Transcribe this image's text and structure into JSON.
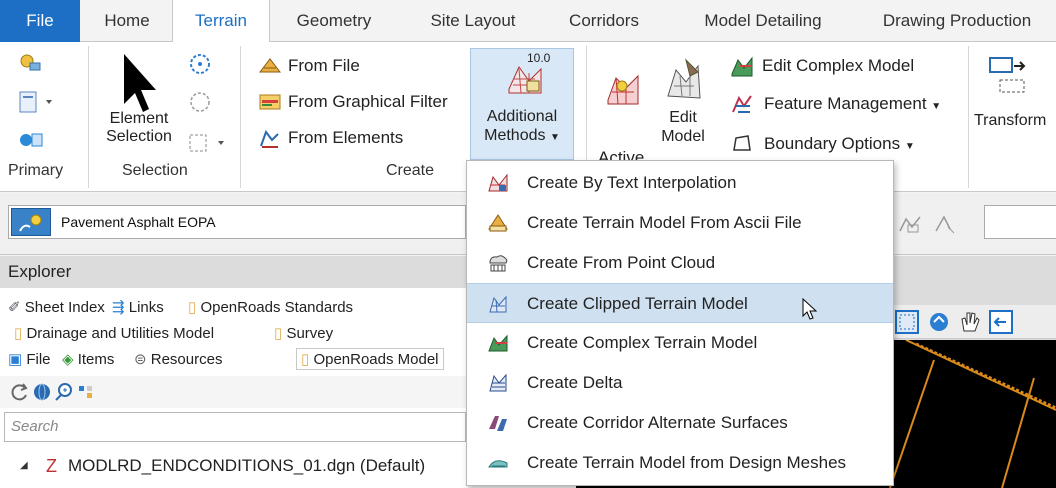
{
  "tabs": [
    "File",
    "Home",
    "Terrain",
    "Geometry",
    "Site Layout",
    "Corridors",
    "Model Detailing",
    "Drawing Production"
  ],
  "ribbon": {
    "primary": {
      "label": "Primary"
    },
    "selection": {
      "label": "Selection",
      "element_selection_line1": "Element",
      "element_selection_line2": "Selection"
    },
    "create": {
      "label": "Create",
      "from_file": "From File",
      "from_graphical_filter": "From Graphical Filter",
      "from_elements": "From Elements"
    },
    "additional_methods": {
      "badge": "10.0",
      "line1": "Additional",
      "line2": "Methods"
    },
    "active": {
      "label": "Active"
    },
    "edit_model": {
      "line1": "Edit",
      "line2": "Model"
    },
    "edit_complex_model": "Edit Complex Model",
    "feature_management": "Feature Management",
    "boundary_options": "Boundary Options",
    "transform": "Transform"
  },
  "feature_bar": {
    "feature_definition": "Pavement Asphalt EOPA"
  },
  "explorer": {
    "title": "Explorer",
    "tabs_row1": [
      "Sheet Index",
      "Links",
      "OpenRoads Standards"
    ],
    "tabs_row2": [
      "Drainage and Utilities Model",
      "Survey"
    ],
    "tabs_row3": [
      "File",
      "Items",
      "Resources",
      "OpenRoads Model"
    ],
    "search_placeholder": "Search",
    "tree_item": "MODLRD_ENDCONDITIONS_01.dgn (Default)"
  },
  "dropdown": {
    "items": [
      "Create By Text Interpolation",
      "Create Terrain Model From Ascii File",
      "Create From Point Cloud",
      "Create Clipped Terrain Model",
      "Create Complex Terrain Model",
      "Create Delta",
      "Create Corridor Alternate Surfaces",
      "Create Terrain Model from Design Meshes"
    ],
    "highlighted_index": 3
  },
  "colors": {
    "accent": "#1c6fc4",
    "highlight": "#cfe0f0",
    "view_background": "#000000",
    "boundary_line": "#d98a1a"
  }
}
